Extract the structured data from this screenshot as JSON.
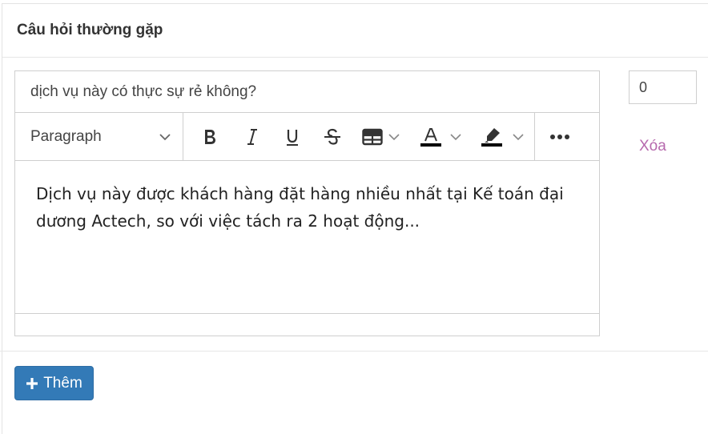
{
  "panel": {
    "title": "Câu hỏi thường gặp"
  },
  "faq_item": {
    "question_value": "dịch vụ này có thực sự rẻ không?",
    "order_value": "0",
    "delete_label": "Xóa",
    "answer_text": "Dịch vụ này được khách hàng đặt hàng nhiều nhất tại Kế toán đại dương Actech, so với việc tách ra 2 hoạt động..."
  },
  "editor": {
    "paragraph_label": "Paragraph",
    "tools": [
      "bold-icon",
      "italic-icon",
      "underline-icon",
      "strikethrough-icon",
      "table-icon",
      "font-color-icon",
      "highlight-icon",
      "more-icon"
    ],
    "font_color": "#000000",
    "highlight_color": "#000000"
  },
  "actions": {
    "add_label": "Thêm"
  },
  "colors": {
    "primary": "#337ab7",
    "delete_link": "#b669ad"
  }
}
